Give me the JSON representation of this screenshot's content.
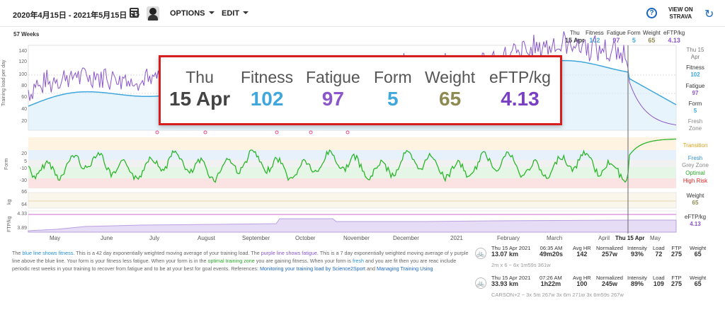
{
  "topbar": {
    "date_range": "2020年4月15日 - 2021年5月15日",
    "calendar_day": "15",
    "options": "OPTIONS",
    "edit": "EDIT",
    "view_on": "VIEW ON",
    "strava": "STRAVA",
    "help": "?",
    "refresh": "↻"
  },
  "weeks": "57 Weeks",
  "header": {
    "day": "Thu",
    "date": "15 Apr",
    "labels": {
      "fitness": "Fitness",
      "fatigue": "Fatigue",
      "form": "Form",
      "weight": "Weight",
      "eftp": "eFTP/kg"
    },
    "values": {
      "fitness": "102",
      "fatigue": "97",
      "form": "5",
      "weight": "65",
      "eftp": "4.13"
    }
  },
  "popup": {
    "day": "Thu",
    "date": "15 Apr",
    "fitness_label": "Fitness",
    "fitness": "102",
    "fatigue_label": "Fatigue",
    "fatigue": "97",
    "form_label": "Form",
    "form": "5",
    "weight_label": "Weight",
    "weight": "65",
    "eftp_label": "eFTP/kg",
    "eftp": "4.13"
  },
  "right_labels": {
    "date_line1": "Thu 15",
    "date_line2": "Apr",
    "fitness_l": "Fitness",
    "fitness_v": "102",
    "fatigue_l": "Fatigue",
    "fatigue_v": "97",
    "form_l": "Form",
    "form_v": "5",
    "fresh_zone": "Fresh Zone",
    "transition": "Transition",
    "fresh": "Fresh",
    "grey_zone": "Grey Zone",
    "optimal": "Optimal",
    "high_risk": "High Risk",
    "weight_l": "Weight",
    "weight_v": "65",
    "eftp_l": "eFTP/kg",
    "eftp_v": "4.13"
  },
  "axes": {
    "load_label": "Training load per day",
    "form_label": "Form",
    "kg_label": "kg",
    "ftp_label": "FTP/kg",
    "load_ticks": [
      "140",
      "120",
      "100",
      "80",
      "60",
      "40",
      "20"
    ],
    "form_ticks": [
      "20",
      "5",
      "-10",
      "-30"
    ],
    "kg_ticks": [
      "66",
      "64"
    ],
    "ftp_ticks": [
      "4.33",
      "3.89"
    ]
  },
  "months": [
    "May",
    "June",
    "July",
    "August",
    "September",
    "October",
    "November",
    "December",
    "2021",
    "February",
    "March",
    "April",
    "Thu 15 Apr",
    "May"
  ],
  "colors": {
    "fitness": "#3fa7dc",
    "fatigue": "#8a56c9",
    "form_fresh": "#2f8fd8",
    "form_grey": "#9e9e9e",
    "form_optimal": "#2cb52c",
    "form_high": "#e02020",
    "transition": "#e5b21f",
    "weight": "#8d8a52",
    "ftp": "#cc55cc",
    "highlight": "#d61e1e"
  },
  "description": {
    "p1": "The ",
    "blue": "blue line shows fitness",
    "p2": ". This is a 42 day exponentially weighted moving average of your training load. The ",
    "purple": "purple line shows fatigue",
    "p3": ". This is a 7 day exponentially weighted moving average of y purple line above the blue line. Your form is your fitness less fatigue. When your form is in the ",
    "optimal": "optimal training zone",
    "p4": " you are gaining fitness. When your form is ",
    "fresh": "fresh",
    "p5": " and you are fit then you are reac include periodic rest weeks in your training to recover from fatigue and to be at your best for goal events. References: ",
    "link1": "Monitoring your training load by Science2Sport",
    "p6": " and ",
    "link2": "Managing Training Using "
  },
  "activities": [
    {
      "date": "Thu 15 Apr 2021",
      "dist": "13.07 km",
      "time": "06:35 AM",
      "dur": "49m20s",
      "hr_l": "Avg HR",
      "hr": "142",
      "np_l": "Normalized",
      "np": "257w",
      "if_l": "Intensity",
      "if": "93%",
      "load_l": "Load",
      "load": "72",
      "ftp_l": "FTP",
      "ftp": "275",
      "wt_l": "Weight",
      "wt": "65",
      "sub_a": "2m x 6 ~ 6x",
      "sub_b": "1m59s 361w"
    },
    {
      "date": "Thu 15 Apr 2021",
      "dist": "33.93 km",
      "time": "07:26 AM",
      "dur": "1h22m",
      "hr_l": "Avg HR",
      "hr": "100",
      "np_l": "Normalized",
      "np": "245w",
      "if_l": "Intensity",
      "if": "89%",
      "load_l": "Load",
      "load": "109",
      "ftp_l": "FTP",
      "ftp": "275",
      "wt_l": "Weight",
      "wt": "65",
      "sub_a": "CARSON+2 ~ 3x",
      "sub_b": "5m 267w   3x  6m 271w   3x  6m59s 267w"
    }
  ]
}
